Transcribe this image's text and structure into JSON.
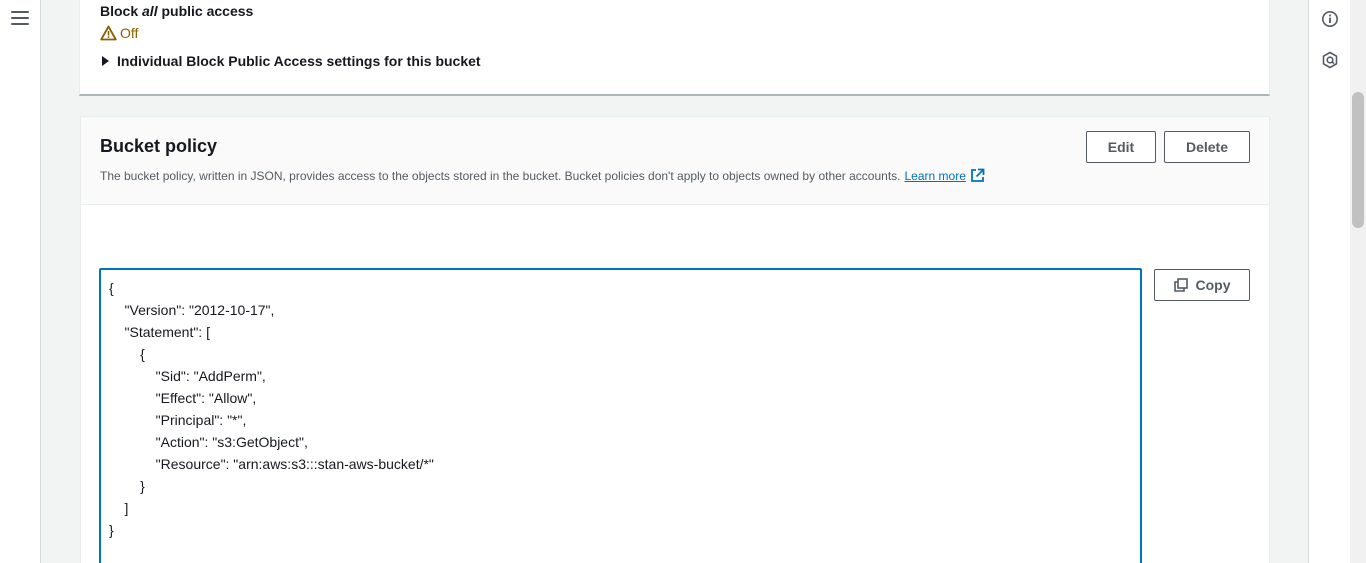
{
  "nav": {
    "menu_icon": "hamburger-menu-icon"
  },
  "right_rail": {
    "icons": [
      "info-circle-icon",
      "hexagon-feedback-icon"
    ]
  },
  "block_public_access": {
    "title_prefix": "Block ",
    "title_emphasis": "all",
    "title_suffix": " public access",
    "status": "Off",
    "status_icon": "warning-triangle-icon",
    "status_color": "#8a6100",
    "expander_label": "Individual Block Public Access settings for this bucket"
  },
  "bucket_policy": {
    "title": "Bucket policy",
    "description": "The bucket policy, written in JSON, provides access to the objects stored in the bucket. Bucket policies don't apply to objects owned by other accounts.",
    "learn_more": "Learn more",
    "edit_label": "Edit",
    "delete_label": "Delete",
    "copy_label": "Copy",
    "policy_lines": [
      "{",
      "    \"Version\": \"2012-10-17\",",
      "    \"Statement\": [",
      "        {",
      "            \"Sid\": \"AddPerm\",",
      "            \"Effect\": \"Allow\",",
      "            \"Principal\": \"*\",",
      "            \"Action\": \"s3:GetObject\",",
      "            \"Resource\": \"arn:aws:s3:::stan-aws-bucket/*\"",
      "        }",
      "    ]",
      "}"
    ]
  },
  "colors": {
    "accent": "#0073bb",
    "warning": "#8a6100",
    "text": "#16191f"
  }
}
